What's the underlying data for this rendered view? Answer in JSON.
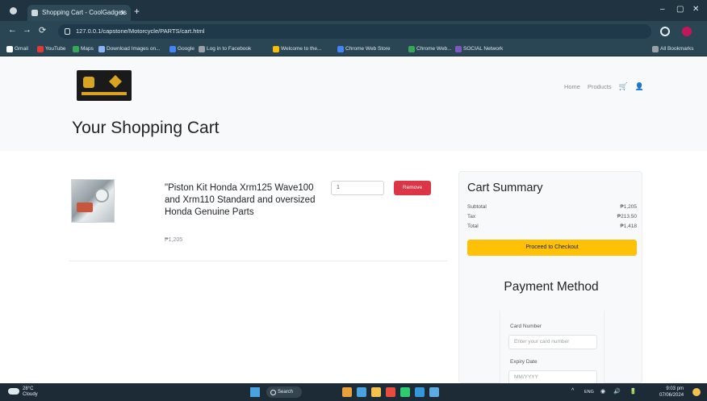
{
  "browser": {
    "tab_title": "Shopping Cart - CoolGadgets",
    "tab_close": "✕",
    "new_tab": "+",
    "address": "127.0.0.1/capstone/Motorcycle/PARTS/cart.html",
    "window_controls": [
      "–",
      "▢",
      "✕"
    ],
    "nav_glyphs": [
      "←",
      "→",
      "⟳"
    ],
    "bookmarks": [
      {
        "label": "Gmail",
        "color": "#ffffff"
      },
      {
        "label": "YouTube",
        "color": "#e53935"
      },
      {
        "label": "Maps",
        "color": "#34a853"
      },
      {
        "label": "Download Images on...",
        "color": "#8ab4f8"
      },
      {
        "label": "Google",
        "color": "#4285f4"
      },
      {
        "label": "Log in to Facebook",
        "color": "#9aa0a5"
      },
      {
        "label": "Welcome to the...",
        "color": "#fbbc05"
      },
      {
        "label": "Chrome Web Store",
        "color": "#4285f4"
      },
      {
        "label": "Chrome Web...",
        "color": "#34a853"
      },
      {
        "label": "SOCIAL Network",
        "color": "#7e57c2"
      }
    ],
    "all_bookmarks": "All Bookmarks"
  },
  "header": {
    "nav_links": [
      "Home",
      "Products"
    ],
    "cart_icon": "cart-icon",
    "user_icon": "user-icon"
  },
  "page": {
    "title": "Your Shopping Cart"
  },
  "cart_item": {
    "name": "\"Piston Kit Honda Xrm125 Wave100 and Xrm110 Standard and oversized Honda Genuine Parts",
    "price": "₱1,205",
    "quantity": "1",
    "remove_label": "Remove"
  },
  "summary": {
    "title": "Cart Summary",
    "rows": [
      {
        "label": "Subtotal",
        "value": "₱1,205"
      },
      {
        "label": "Tax",
        "value": "₱213.50"
      },
      {
        "label": "Total",
        "value": "₱1,418"
      }
    ],
    "checkout_label": "Proceed to Checkout"
  },
  "payment": {
    "title": "Payment Method",
    "card_number_label": "Card Number",
    "card_number_placeholder": "Enter your card number",
    "expiry_label": "Expiry Date",
    "expiry_placeholder": "MM/YYYY"
  },
  "taskbar": {
    "weather_temp": "28°C",
    "weather_desc": "Cloudy",
    "search_label": "Search",
    "app_colors": [
      "#e9a23b",
      "#4aa3df",
      "#f2c14e",
      "#e74c3c",
      "#2ecc71",
      "#3498db",
      "#5dade2"
    ],
    "tray_glyphs": [
      "^",
      "ENG",
      "◉",
      "🔊",
      "🔋"
    ],
    "time": "9:03 pm",
    "date": "07/06/2024"
  },
  "colors": {
    "remove": "#dc3545",
    "checkout": "#ffc107",
    "chrome_dark": "#1f3440"
  }
}
